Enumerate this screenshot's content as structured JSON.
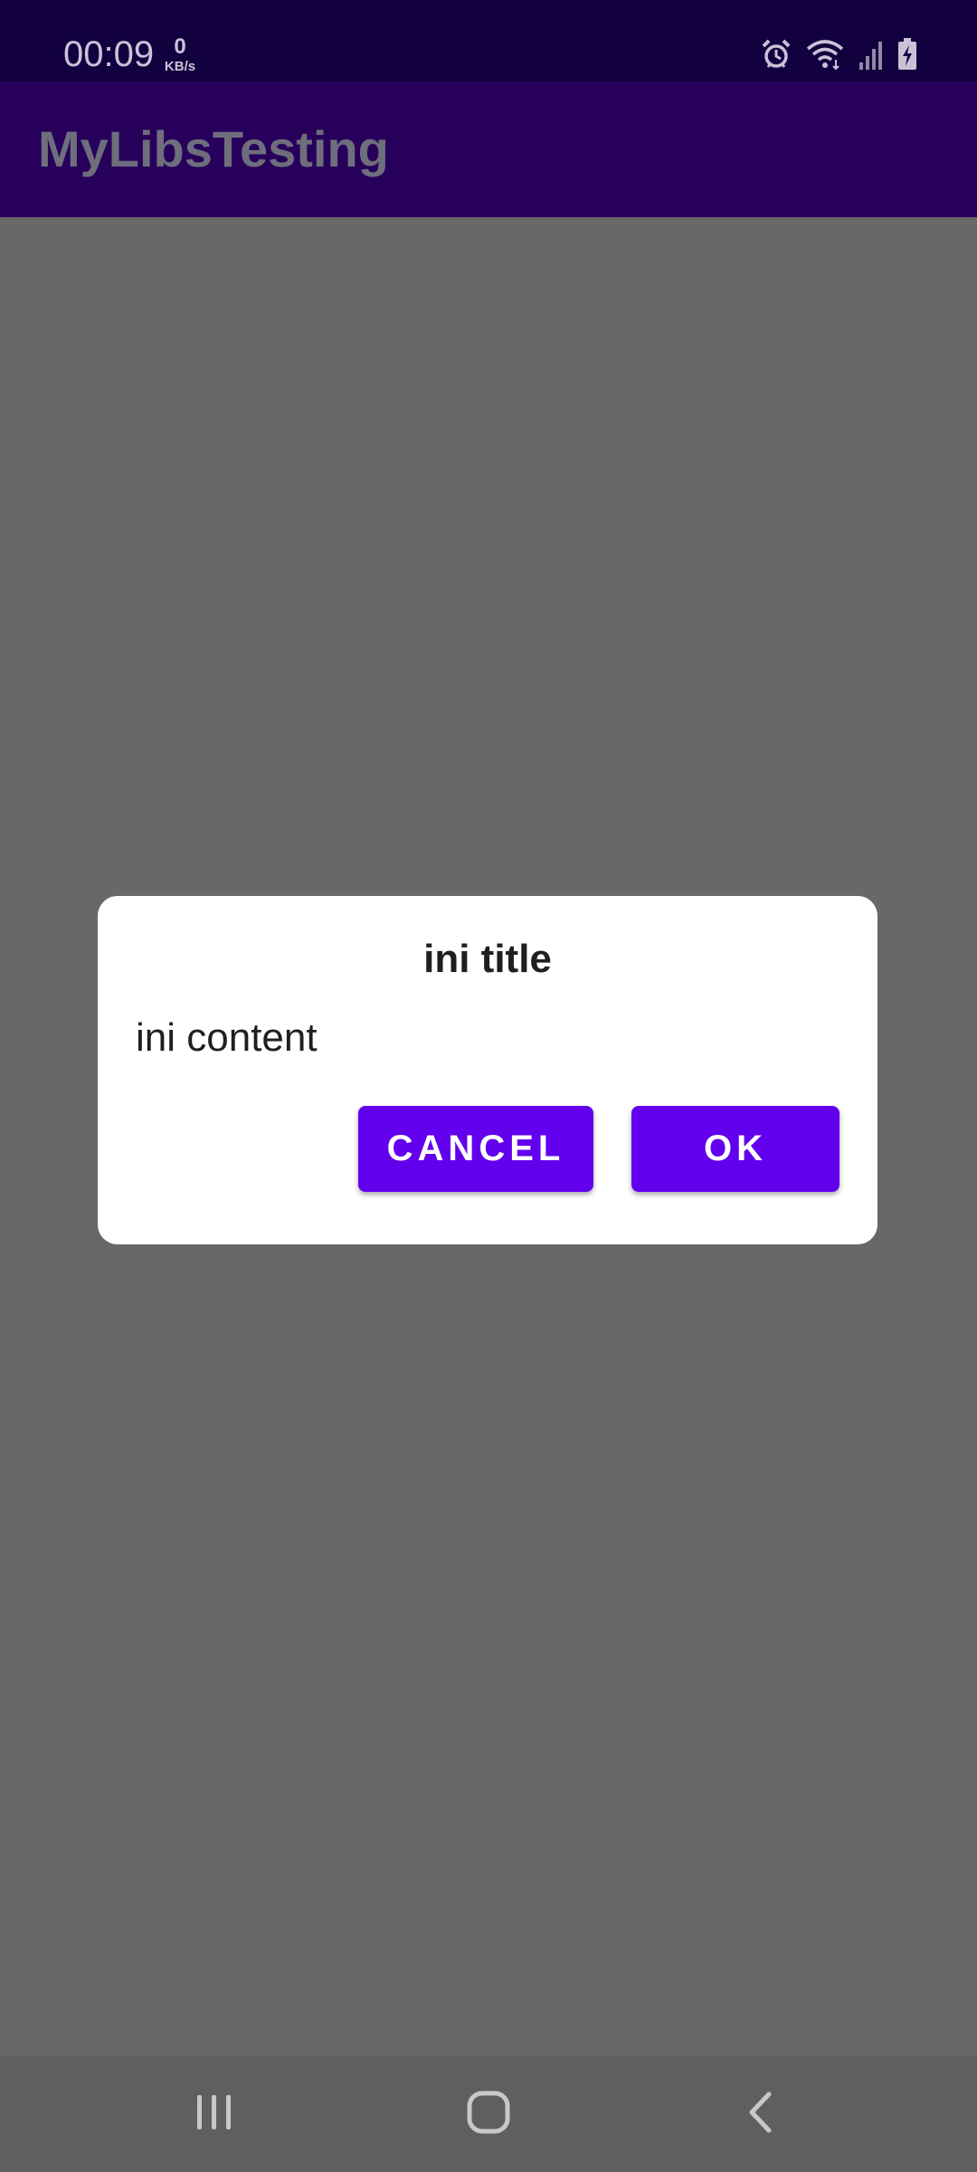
{
  "status_bar": {
    "time": "00:09",
    "net_speed_value": "0",
    "net_speed_unit": "KB/s",
    "icons": [
      "alarm-icon",
      "wifi-icon",
      "signal-icon",
      "battery-charging-icon"
    ]
  },
  "app_bar": {
    "title": "MyLibsTesting"
  },
  "dialog": {
    "title": "ini title",
    "content": "ini content",
    "cancel_label": "CANCEL",
    "ok_label": "OK"
  },
  "nav_bar": {
    "icons": [
      "recent-apps-icon",
      "home-icon",
      "back-icon"
    ]
  },
  "colors": {
    "status_bar": "#12003f",
    "app_bar": "#27005c",
    "scrim_background": "#686868",
    "button": "#6200ee",
    "dialog": "#ffffff"
  }
}
